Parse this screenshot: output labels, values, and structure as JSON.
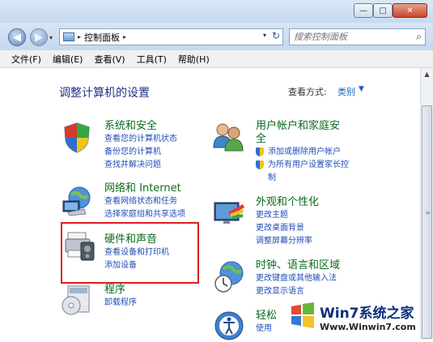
{
  "titlebar": {
    "min": "—",
    "max": "□",
    "close": "✕"
  },
  "nav": {
    "back": "◀",
    "forward": "▶",
    "history": "▾"
  },
  "address": {
    "arrow1": "▸",
    "location": "控制面板",
    "arrow2": "▸",
    "dropdown": "▾",
    "refresh": "↻"
  },
  "search": {
    "placeholder": "搜索控制面板",
    "icon": "⌕"
  },
  "menu": [
    "文件(F)",
    "编辑(E)",
    "查看(V)",
    "工具(T)",
    "帮助(H)"
  ],
  "heading": "调整计算机的设置",
  "view_by": {
    "label": "查看方式:",
    "value": "类别",
    "caret": "▼"
  },
  "categories": [
    {
      "title": "系统和安全",
      "links": [
        "查看您的计算机状态",
        "备份您的计算机",
        "查找并解决问题"
      ]
    },
    {
      "title": "网络和 Internet",
      "links": [
        "查看网络状态和任务",
        "选择家庭组和共享选项"
      ]
    },
    {
      "title": "硬件和声音",
      "links": [
        "查看设备和打印机",
        "添加设备"
      ]
    },
    {
      "title": "程序",
      "links": [
        "卸载程序"
      ]
    },
    {
      "title": "用户帐户和家庭安",
      "title2": "全",
      "links": [
        "添加或删除用户帐户",
        "为所有用户设置家长控",
        "制"
      ]
    },
    {
      "title": "外观和个性化",
      "links": [
        "更改主题",
        "更改桌面背景",
        "调整屏幕分辨率"
      ]
    },
    {
      "title": "时钟、语言和区域",
      "links": [
        "更改键盘或其他输入法",
        "更改显示语言"
      ]
    },
    {
      "title": "轻松",
      "links": [
        "使用"
      ]
    }
  ],
  "scrollbar": {
    "up": "▲",
    "grip": "≡"
  },
  "watermark": {
    "text": "Win7系统之家",
    "url": "Www.Winwin7.com"
  },
  "colors": {
    "category_title": "#0b6a1f",
    "link": "#1f4eb4",
    "heading": "#1e3287",
    "highlight": "#d81d1d"
  }
}
